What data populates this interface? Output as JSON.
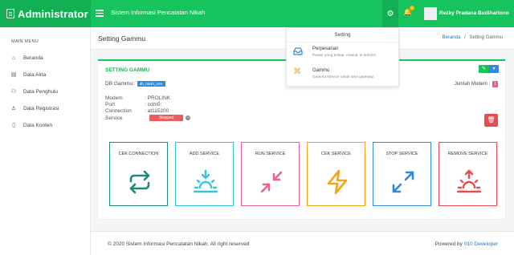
{
  "header": {
    "brand": "Administrator",
    "app_title": "Sistem Informasi Pencatatan Nikah",
    "notification_count": "1",
    "user_name": "Rezky Pradana Budihartono"
  },
  "sidebar": {
    "menu_header": "MAIN MENU",
    "items": [
      {
        "label": "Beranda",
        "icon": "home-icon"
      },
      {
        "label": "Data Akta",
        "icon": "document-icon"
      },
      {
        "label": "Data Penghulu",
        "icon": "users-icon"
      },
      {
        "label": "Data Registrasi",
        "icon": "user-icon"
      },
      {
        "label": "Data Konten",
        "icon": "book-icon"
      }
    ]
  },
  "page": {
    "title": "Setting Gammu",
    "breadcrumb": [
      "Beranda",
      "Setting Gammu"
    ],
    "breadcrumb_sep": "/"
  },
  "card": {
    "title": "SETTING GAMMU",
    "db_label": "DB Gammu :",
    "db_value": "db_nikah_sms",
    "modem_count_label": "Jumlah Modem :",
    "modem_count": "1",
    "info": [
      {
        "key": "Modem",
        "value": ": PROLINK"
      },
      {
        "key": "Port",
        "value": ": com5:"
      },
      {
        "key": "Connection",
        "value": ": at115200"
      },
      {
        "key": "Service",
        "value": ":"
      }
    ],
    "service_status": "Stopped"
  },
  "services": [
    {
      "label": "CEK CONNECTION",
      "color": "#1a8a7a",
      "icon": "refresh-arrows-icon"
    },
    {
      "label": "ADD SERVICE",
      "color": "#36c4dc",
      "icon": "sunrise-icon"
    },
    {
      "label": "RUN SERVICE",
      "color": "#ee5f9a",
      "icon": "shrink-arrows-icon"
    },
    {
      "label": "CEK SERVICE",
      "color": "#f7a31a",
      "icon": "lightning-icon"
    },
    {
      "label": "STOP SERVICE",
      "color": "#2d8ae0",
      "icon": "expand-arrows-icon"
    },
    {
      "label": "REMOVE SERVICE",
      "color": "#e84c4c",
      "icon": "sunset-icon"
    }
  ],
  "dropdown": {
    "header": "Setting",
    "items": [
      {
        "title": "Perpesanan",
        "desc": "Pesan yang keluar, masuk, & terkirim.",
        "color": "#2d8ae0",
        "icon": "inbox-icon"
      },
      {
        "title": "Gammu",
        "desc": "Gammu service untuk sms gateway.",
        "color": "#f7a31a",
        "icon": "command-icon"
      }
    ]
  },
  "footer": {
    "copyright": "© 2020 Sistem Informasi Pencatatan Nikah. All right reserved",
    "powered_label": "Powered by",
    "powered_link": "010 Developer"
  }
}
